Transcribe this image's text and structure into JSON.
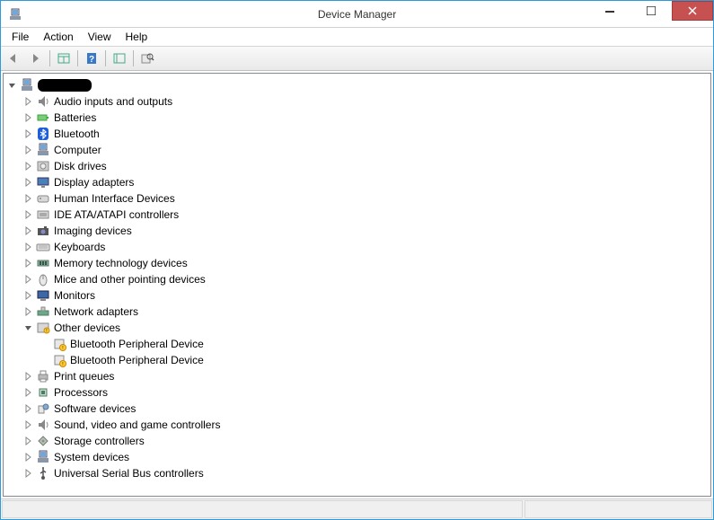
{
  "window": {
    "title": "Device Manager"
  },
  "menu": {
    "file": "File",
    "action": "Action",
    "view": "View",
    "help": "Help"
  },
  "tree": {
    "root_redacted": true,
    "categories": [
      {
        "icon": "audio",
        "label": "Audio inputs and outputs"
      },
      {
        "icon": "battery",
        "label": "Batteries"
      },
      {
        "icon": "bluetooth",
        "label": "Bluetooth"
      },
      {
        "icon": "computer",
        "label": "Computer"
      },
      {
        "icon": "disk",
        "label": "Disk drives"
      },
      {
        "icon": "display",
        "label": "Display adapters"
      },
      {
        "icon": "hid",
        "label": "Human Interface Devices"
      },
      {
        "icon": "ide",
        "label": "IDE ATA/ATAPI controllers"
      },
      {
        "icon": "imaging",
        "label": "Imaging devices"
      },
      {
        "icon": "keyboard",
        "label": "Keyboards"
      },
      {
        "icon": "memory",
        "label": "Memory technology devices"
      },
      {
        "icon": "mouse",
        "label": "Mice and other pointing devices"
      },
      {
        "icon": "monitor",
        "label": "Monitors"
      },
      {
        "icon": "network",
        "label": "Network adapters"
      },
      {
        "icon": "other",
        "label": "Other devices",
        "expanded": true,
        "children": [
          {
            "icon": "unknown",
            "label": "Bluetooth Peripheral Device"
          },
          {
            "icon": "unknown",
            "label": "Bluetooth Peripheral Device"
          }
        ]
      },
      {
        "icon": "printer",
        "label": "Print queues"
      },
      {
        "icon": "cpu",
        "label": "Processors"
      },
      {
        "icon": "software",
        "label": "Software devices"
      },
      {
        "icon": "sound",
        "label": "Sound, video and game controllers"
      },
      {
        "icon": "storage",
        "label": "Storage controllers"
      },
      {
        "icon": "system",
        "label": "System devices"
      },
      {
        "icon": "usb",
        "label": "Universal Serial Bus controllers"
      }
    ]
  }
}
